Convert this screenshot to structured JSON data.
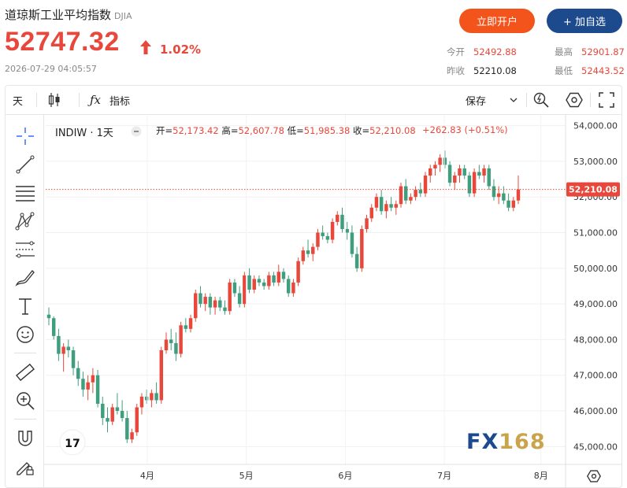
{
  "header": {
    "title": "道琼斯工业平均指数",
    "code": "DJIA",
    "price": "52747.32",
    "change_pct": "1.02%",
    "timestamp": "2026-07-29 04:05:57",
    "open_account_label": "立即开户",
    "add_watch_label": "+ 加自选",
    "stats": {
      "open_label": "今开",
      "open_value": "52492.88",
      "prev_close_label": "昨收",
      "prev_close_value": "52210.08",
      "high_label": "最高",
      "high_value": "52901.87",
      "low_label": "最低",
      "low_value": "52443.52"
    }
  },
  "toolbar": {
    "interval_label": "天",
    "indicator_label": "指标",
    "save_label": "保存"
  },
  "legend": {
    "symbol": "INDIW · 1天",
    "open_label": "开=",
    "open_value": "52,173.42",
    "high_label": "高=",
    "high_value": "52,607.78",
    "low_label": "低=",
    "low_value": "51,985.38",
    "close_label": "收=",
    "close_value": "52,210.08",
    "change": "+262.83 (+0.51%)"
  },
  "watermark": {
    "fx": "FX",
    "num": "168"
  },
  "colors": {
    "up": "#e8483b",
    "down": "#3f9e7e",
    "accent_orange": "#f2541b",
    "accent_blue": "#1d4a8c"
  },
  "chart_data": {
    "type": "candlestick",
    "xlabels": [
      "4月",
      "5月",
      "6月",
      "7月",
      "8月"
    ],
    "y_ticks": [
      "54,000.00",
      "53,000.00",
      "52,000.00",
      "51,000.00",
      "50,000.00",
      "49,000.00",
      "48,000.00",
      "47,000.00",
      "46,000.00",
      "45,000.00"
    ],
    "ylim": [
      44500,
      54300
    ],
    "last_price_label": "52,210.08",
    "last_price": 52210.08,
    "grid": true,
    "candles": [
      [
        48700,
        48900,
        48400,
        48600
      ],
      [
        48600,
        48650,
        48000,
        48100
      ],
      [
        48100,
        48300,
        47400,
        47600
      ],
      [
        47600,
        47900,
        47100,
        47800
      ],
      [
        47800,
        48000,
        47500,
        47700
      ],
      [
        47700,
        47800,
        47000,
        47200
      ],
      [
        47200,
        47400,
        46700,
        46900
      ],
      [
        46900,
        47100,
        46400,
        46600
      ],
      [
        46600,
        47000,
        46300,
        46800
      ],
      [
        46800,
        47200,
        46500,
        47000
      ],
      [
        47000,
        47150,
        46100,
        46200
      ],
      [
        46200,
        46400,
        45600,
        45800
      ],
      [
        45800,
        46100,
        45400,
        45700
      ],
      [
        45700,
        46200,
        45600,
        46100
      ],
      [
        46100,
        46500,
        45900,
        46000
      ],
      [
        46000,
        46300,
        45700,
        45800
      ],
      [
        45800,
        46000,
        45100,
        45200
      ],
      [
        45200,
        45500,
        45100,
        45400
      ],
      [
        45400,
        46200,
        45300,
        46100
      ],
      [
        46100,
        46500,
        45900,
        46400
      ],
      [
        46400,
        46600,
        46200,
        46300
      ],
      [
        46300,
        46600,
        46100,
        46500
      ],
      [
        46500,
        46800,
        46200,
        46300
      ],
      [
        46300,
        47800,
        46200,
        47700
      ],
      [
        47700,
        48200,
        47600,
        48000
      ],
      [
        48000,
        48300,
        47700,
        47900
      ],
      [
        47900,
        48200,
        47400,
        47600
      ],
      [
        47600,
        48500,
        47500,
        48400
      ],
      [
        48400,
        48600,
        48200,
        48300
      ],
      [
        48300,
        48700,
        48200,
        48600
      ],
      [
        48600,
        49400,
        48500,
        49300
      ],
      [
        49300,
        49500,
        48900,
        49000
      ],
      [
        49000,
        49300,
        48800,
        49200
      ],
      [
        49200,
        49300,
        48700,
        48900
      ],
      [
        48900,
        49200,
        48700,
        49100
      ],
      [
        49100,
        49200,
        48800,
        48900
      ],
      [
        48900,
        49100,
        48700,
        48800
      ],
      [
        48800,
        49700,
        48700,
        49600
      ],
      [
        49600,
        49700,
        49200,
        49300
      ],
      [
        49300,
        49500,
        48900,
        49000
      ],
      [
        49000,
        49900,
        48900,
        49800
      ],
      [
        49800,
        50000,
        49300,
        49400
      ],
      [
        49400,
        49800,
        49300,
        49700
      ],
      [
        49700,
        49800,
        49500,
        49600
      ],
      [
        49600,
        49700,
        49400,
        49500
      ],
      [
        49500,
        49900,
        49400,
        49800
      ],
      [
        49800,
        49900,
        49500,
        49600
      ],
      [
        49600,
        50100,
        49500,
        49900
      ],
      [
        49900,
        50000,
        49600,
        49700
      ],
      [
        49700,
        49800,
        49200,
        49300
      ],
      [
        49300,
        49700,
        49200,
        49600
      ],
      [
        49600,
        50300,
        49500,
        50200
      ],
      [
        50200,
        50600,
        50100,
        50500
      ],
      [
        50500,
        50800,
        50300,
        50400
      ],
      [
        50400,
        50700,
        50200,
        50600
      ],
      [
        50600,
        51100,
        50500,
        51000
      ],
      [
        51000,
        51200,
        50800,
        50900
      ],
      [
        50900,
        51000,
        50700,
        50800
      ],
      [
        50800,
        51400,
        50700,
        51300
      ],
      [
        51300,
        51600,
        51200,
        51500
      ],
      [
        51500,
        51700,
        51000,
        51100
      ],
      [
        51100,
        51300,
        50800,
        51000
      ],
      [
        51000,
        51200,
        50300,
        50400
      ],
      [
        50400,
        50600,
        49900,
        50000
      ],
      [
        50000,
        51200,
        49900,
        51100
      ],
      [
        51100,
        51500,
        51000,
        51400
      ],
      [
        51400,
        51800,
        51300,
        51700
      ],
      [
        51700,
        52100,
        51600,
        52000
      ],
      [
        52000,
        52200,
        51500,
        51600
      ],
      [
        51600,
        51900,
        51400,
        51800
      ],
      [
        51800,
        52000,
        51600,
        51700
      ],
      [
        51700,
        51900,
        51500,
        51800
      ],
      [
        51800,
        52400,
        51700,
        52300
      ],
      [
        52300,
        52500,
        51800,
        51900
      ],
      [
        51900,
        52100,
        51800,
        52000
      ],
      [
        52000,
        52300,
        51900,
        52200
      ],
      [
        52200,
        52400,
        52000,
        52100
      ],
      [
        52100,
        52700,
        52000,
        52600
      ],
      [
        52600,
        52900,
        52400,
        52800
      ],
      [
        52800,
        53000,
        52600,
        52900
      ],
      [
        52900,
        53200,
        52700,
        53100
      ],
      [
        53100,
        53300,
        52800,
        52900
      ],
      [
        52900,
        53000,
        52300,
        52400
      ],
      [
        52400,
        52700,
        52200,
        52600
      ],
      [
        52600,
        52900,
        52400,
        52800
      ],
      [
        52800,
        52900,
        52500,
        52600
      ],
      [
        52600,
        52700,
        52000,
        52100
      ],
      [
        52100,
        52800,
        52000,
        52700
      ],
      [
        52700,
        52900,
        52500,
        52600
      ],
      [
        52600,
        52900,
        52400,
        52800
      ],
      [
        52800,
        52900,
        52200,
        52300
      ],
      [
        52300,
        52500,
        51900,
        52000
      ],
      [
        52000,
        52300,
        51800,
        52100
      ],
      [
        52100,
        52300,
        51800,
        51900
      ],
      [
        51900,
        52100,
        51600,
        51700
      ],
      [
        51700,
        52000,
        51600,
        51900
      ],
      [
        51900,
        52600,
        51800,
        52210
      ]
    ]
  }
}
